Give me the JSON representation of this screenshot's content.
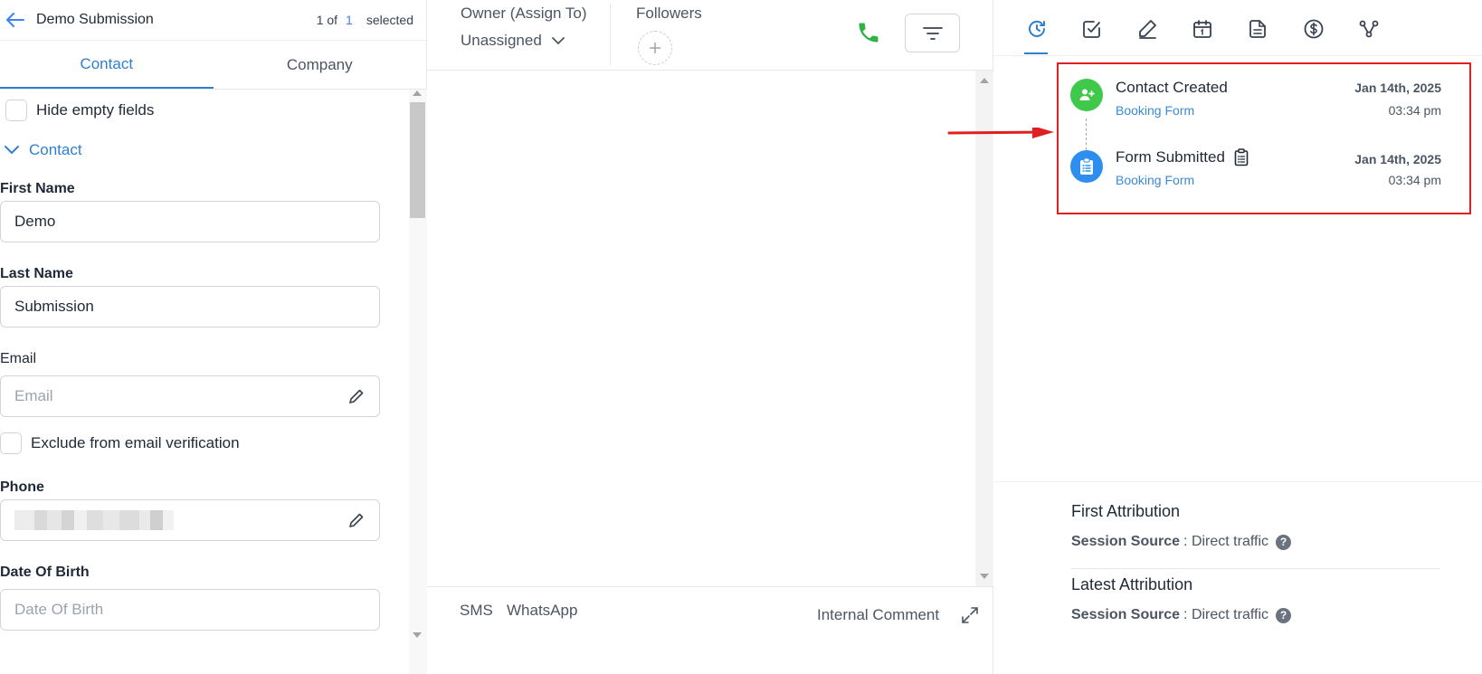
{
  "header": {
    "contact_name": "Demo Submission",
    "pager_current": "1 of",
    "pager_count": "1",
    "pager_suffix": "selected"
  },
  "tabs": [
    {
      "label": "Contact",
      "active": true
    },
    {
      "label": "Company",
      "active": false
    }
  ],
  "form": {
    "hide_empty_label": "Hide empty fields",
    "section_label": "Contact",
    "first_name_label": "First Name",
    "first_name_value": "Demo",
    "last_name_label": "Last Name",
    "last_name_value": "Submission",
    "email_label": "Email",
    "email_placeholder": "Email",
    "exclude_email_label": "Exclude from email verification",
    "phone_label": "Phone",
    "dob_label": "Date Of Birth",
    "dob_placeholder": "Date Of Birth"
  },
  "middle": {
    "owner_label": "Owner (Assign To)",
    "owner_value": "Unassigned",
    "followers_label": "Followers",
    "channels": [
      "SMS",
      "WhatsApp"
    ],
    "internal_comment": "Internal Comment"
  },
  "right": {
    "icons": [
      "activity-icon",
      "task-icon",
      "note-icon",
      "calendar-icon",
      "document-icon",
      "payment-icon",
      "workflow-icon"
    ],
    "events": [
      {
        "title": "Contact Created",
        "source": "Booking Form",
        "date": "Jan 14th, 2025",
        "time": "03:34 pm",
        "color": "#3ec94a"
      },
      {
        "title": "Form Submitted",
        "source": "Booking Form",
        "date": "Jan 14th, 2025",
        "time": "03:34 pm",
        "color": "#2d8ef0"
      }
    ],
    "first_attribution_title": "First Attribution",
    "latest_attribution_title": "Latest Attribution",
    "session_source_label": "Session Source",
    "first_session_source_value": ": Direct traffic",
    "latest_session_source_value": ": Direct traffic"
  },
  "colors": {
    "accent": "#2f80d1",
    "phone_green": "#2fb344",
    "highlight_red": "#e02020"
  }
}
